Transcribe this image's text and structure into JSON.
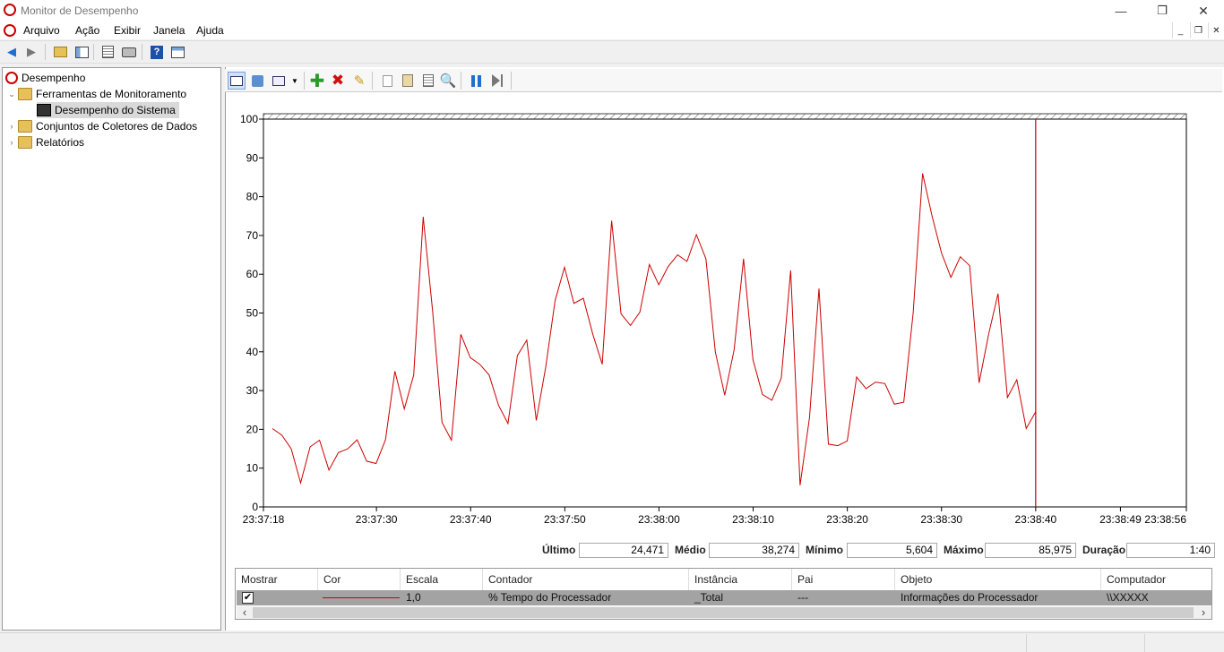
{
  "window": {
    "title": "Monitor de Desempenho",
    "minimize": "—",
    "restore": "❐",
    "close": "✕"
  },
  "menu": {
    "items": [
      "Arquivo",
      "Ação",
      "Exibir",
      "Janela",
      "Ajuda"
    ],
    "mdi_min": "_",
    "mdi_restore": "❐",
    "mdi_close": "✕"
  },
  "tree": {
    "root": "Desempenho",
    "monitoring_tools": "Ferramentas de Monitoramento",
    "system_performance": "Desempenho do Sistema",
    "collector_sets": "Conjuntos de Coletores de Dados",
    "reports": "Relatórios"
  },
  "stats": {
    "last_label": "Último",
    "last_value": "24,471",
    "avg_label": "Médio",
    "avg_value": "38,274",
    "min_label": "Mínimo",
    "min_value": "5,604",
    "max_label": "Máximo",
    "max_value": "85,975",
    "duration_label": "Duração",
    "duration_value": "1:40"
  },
  "table": {
    "headers": [
      "Mostrar",
      "Cor",
      "Escala",
      "Contador",
      "Instância",
      "Pai",
      "Objeto",
      "Computador"
    ],
    "row": {
      "show": "✔",
      "scale": "1,0",
      "counter": "% Tempo do Processador",
      "instance": "_Total",
      "parent": "---",
      "object": "Informações do Processador",
      "computer": "\\\\XXXXX"
    },
    "scroll_left": "‹",
    "scroll_right": "›"
  },
  "colors": {
    "series": "#cc0000",
    "accent": "#0078d7"
  },
  "chart_data": {
    "type": "line",
    "ylim": [
      0,
      100
    ],
    "yticks": [
      0,
      10,
      20,
      30,
      40,
      50,
      60,
      70,
      80,
      90,
      100
    ],
    "xticks": [
      "23:37:18",
      "23:37:30",
      "23:37:40",
      "23:37:50",
      "23:38:00",
      "23:38:10",
      "23:38:20",
      "23:38:30",
      "23:38:40",
      "23:38:49",
      "23:38:56"
    ],
    "grid": false,
    "current_time": "23:38:40",
    "series": [
      {
        "values": [
          20.2,
          18.5,
          15,
          6.2,
          15.5,
          17.2,
          9.5,
          14,
          15,
          17.3,
          11.8,
          11.2,
          17.3,
          35,
          25.3,
          34,
          74.8,
          50.5,
          21.8,
          17.2,
          44.5,
          38.5,
          36.8,
          34,
          26.2,
          21.5,
          39,
          43,
          22.3,
          36,
          53.2,
          61.8,
          52.5,
          53.8,
          44.5,
          36.8,
          73.8,
          49.8,
          46.8,
          50.2,
          62.5,
          57.3,
          62,
          65,
          63.3,
          70.2,
          64,
          40,
          28.8,
          40.5,
          64,
          38,
          29,
          27.5,
          33.2,
          61,
          5.6,
          23,
          56.3,
          16.2,
          15.8,
          17,
          33.5,
          30.5,
          32.2,
          31.8,
          26.5,
          27,
          50,
          86,
          75,
          65.5,
          59.2,
          64.5,
          62.2,
          32,
          44.5,
          55,
          28.2,
          32.8,
          20.2,
          24.5
        ]
      }
    ]
  }
}
